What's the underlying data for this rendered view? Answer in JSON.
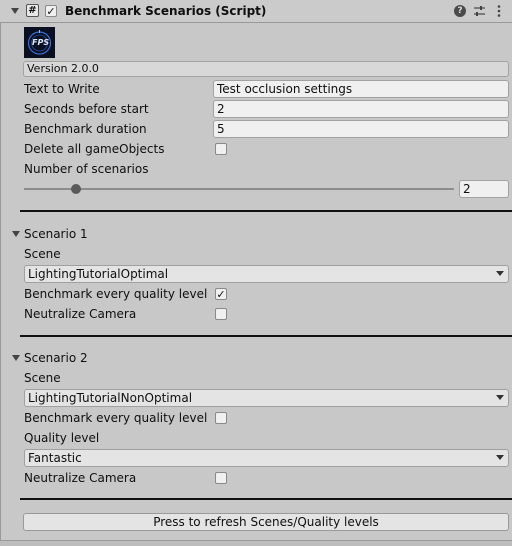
{
  "header": {
    "title": "Benchmark Scenarios (Script)",
    "script_icon": "#",
    "enabled": true
  },
  "logo": {
    "text": "FPS"
  },
  "version": "Version 2.0.0",
  "fields": {
    "text_to_write": {
      "label": "Text to Write",
      "value": "Test occlusion settings"
    },
    "seconds_before_start": {
      "label": "Seconds before start",
      "value": "2"
    },
    "benchmark_duration": {
      "label": "Benchmark duration",
      "value": "5"
    },
    "delete_all": {
      "label": "Delete all gameObjects",
      "checked": false
    },
    "number_of_scenarios": {
      "label": "Number of scenarios",
      "value": "2",
      "slider_fraction": 0.12
    }
  },
  "scenarios": [
    {
      "title": "Scenario 1",
      "scene_label": "Scene",
      "scene_value": "LightingTutorialOptimal",
      "benchmark_label": "Benchmark every quality level",
      "benchmark_checked": true,
      "neutralize_label": "Neutralize Camera",
      "neutralize_checked": false
    },
    {
      "title": "Scenario 2",
      "scene_label": "Scene",
      "scene_value": "LightingTutorialNonOptimal",
      "benchmark_label": "Benchmark every quality level",
      "benchmark_checked": false,
      "quality_label": "Quality level",
      "quality_value": "Fantastic",
      "neutralize_label": "Neutralize Camera",
      "neutralize_checked": false
    }
  ],
  "refresh_button": "Press to refresh Scenes/Quality levels",
  "checkmark": "✓"
}
